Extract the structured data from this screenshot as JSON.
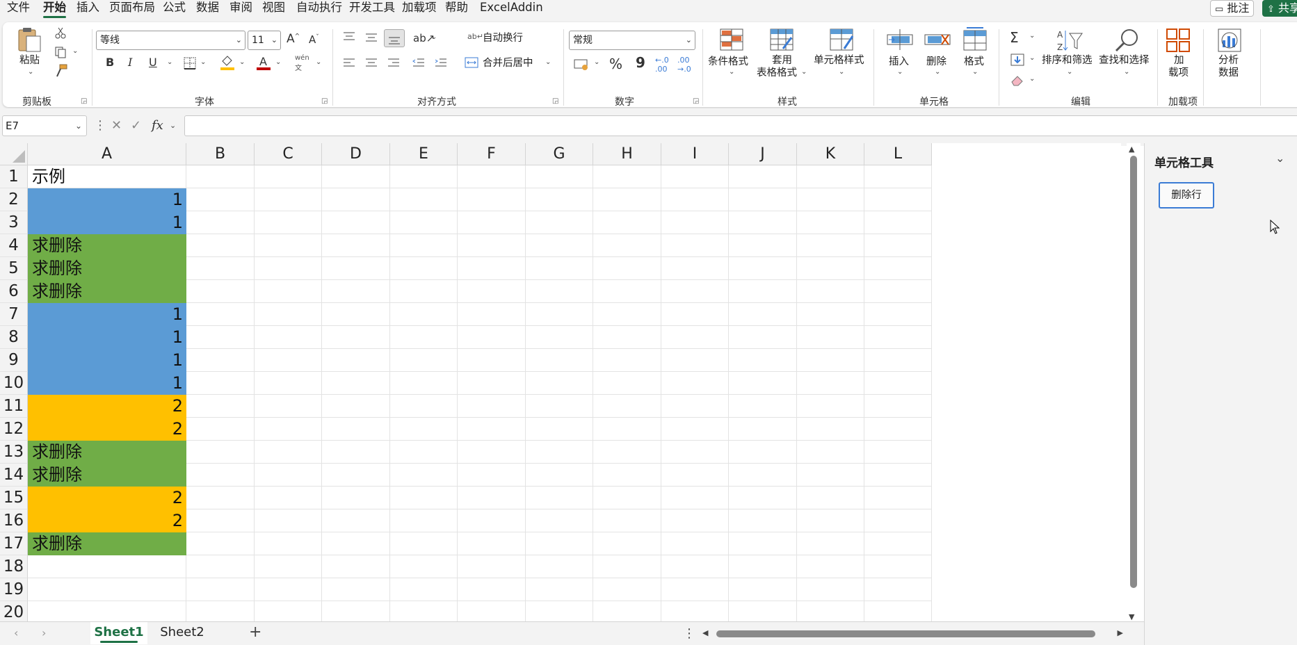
{
  "menu": {
    "tabs": [
      "文件",
      "开始",
      "插入",
      "页面布局",
      "公式",
      "数据",
      "审阅",
      "视图",
      "自动执行",
      "开发工具",
      "加载项",
      "帮助",
      "ExcelAddin"
    ],
    "active_index": 1,
    "comments_label": "批注",
    "share_label": "共享"
  },
  "ribbon": {
    "clipboard": {
      "paste": "粘贴",
      "group": "剪贴板"
    },
    "font": {
      "name": "等线",
      "size": "11",
      "group": "字体",
      "bold": "B",
      "italic": "I",
      "underline": "U"
    },
    "alignment": {
      "wrap": "自动换行",
      "merge": "合并后居中",
      "group": "对齐方式"
    },
    "number": {
      "format": "常规",
      "group": "数字",
      "percent": "%",
      "comma": "9"
    },
    "styles": {
      "conditional": "条件格式",
      "table_line1": "套用",
      "table_line2": "表格格式",
      "cell_styles": "单元格样式",
      "group": "样式"
    },
    "cells": {
      "insert": "插入",
      "delete": "删除",
      "format": "格式",
      "group": "单元格"
    },
    "editing": {
      "sort": "排序和筛选",
      "find": "查找和选择",
      "group": "编辑"
    },
    "addins": {
      "line1": "加",
      "line2": "载项",
      "group": "加载项"
    },
    "analysis": {
      "line1": "分析",
      "line2": "数据"
    }
  },
  "formula_bar": {
    "name_box": "E7",
    "fx": "fx",
    "value": ""
  },
  "sheet": {
    "columns": [
      "A",
      "B",
      "C",
      "D",
      "E",
      "F",
      "G",
      "H",
      "I",
      "J",
      "K",
      "L"
    ],
    "rows": [
      {
        "n": "1",
        "value": "示例",
        "kind": "text",
        "fill": ""
      },
      {
        "n": "2",
        "value": "1",
        "kind": "num",
        "fill": "#5b9bd5"
      },
      {
        "n": "3",
        "value": "1",
        "kind": "num",
        "fill": "#5b9bd5"
      },
      {
        "n": "4",
        "value": "求删除",
        "kind": "text",
        "fill": "#70ad47"
      },
      {
        "n": "5",
        "value": "求删除",
        "kind": "text",
        "fill": "#70ad47"
      },
      {
        "n": "6",
        "value": "求删除",
        "kind": "text",
        "fill": "#70ad47"
      },
      {
        "n": "7",
        "value": "1",
        "kind": "num",
        "fill": "#5b9bd5"
      },
      {
        "n": "8",
        "value": "1",
        "kind": "num",
        "fill": "#5b9bd5"
      },
      {
        "n": "9",
        "value": "1",
        "kind": "num",
        "fill": "#5b9bd5"
      },
      {
        "n": "10",
        "value": "1",
        "kind": "num",
        "fill": "#5b9bd5"
      },
      {
        "n": "11",
        "value": "2",
        "kind": "num",
        "fill": "#ffc000"
      },
      {
        "n": "12",
        "value": "2",
        "kind": "num",
        "fill": "#ffc000"
      },
      {
        "n": "13",
        "value": "求删除",
        "kind": "text",
        "fill": "#70ad47"
      },
      {
        "n": "14",
        "value": "求删除",
        "kind": "text",
        "fill": "#70ad47"
      },
      {
        "n": "15",
        "value": "2",
        "kind": "num",
        "fill": "#ffc000"
      },
      {
        "n": "16",
        "value": "2",
        "kind": "num",
        "fill": "#ffc000"
      },
      {
        "n": "17",
        "value": "求删除",
        "kind": "text",
        "fill": "#70ad47"
      },
      {
        "n": "18",
        "value": "",
        "kind": "text",
        "fill": ""
      },
      {
        "n": "19",
        "value": "",
        "kind": "text",
        "fill": ""
      },
      {
        "n": "20",
        "value": "",
        "kind": "text",
        "fill": ""
      }
    ],
    "tabs": [
      "Sheet1",
      "Sheet2"
    ],
    "active_tab": 0,
    "add_sheet": "+"
  },
  "task_pane": {
    "title": "单元格工具",
    "delete_rows_button": "删除行"
  },
  "colors": {
    "accent": "#1e7145",
    "blue_fill": "#5b9bd5",
    "green_fill": "#70ad47",
    "orange_fill": "#ffc000",
    "focus_border": "#3a7bd5"
  }
}
